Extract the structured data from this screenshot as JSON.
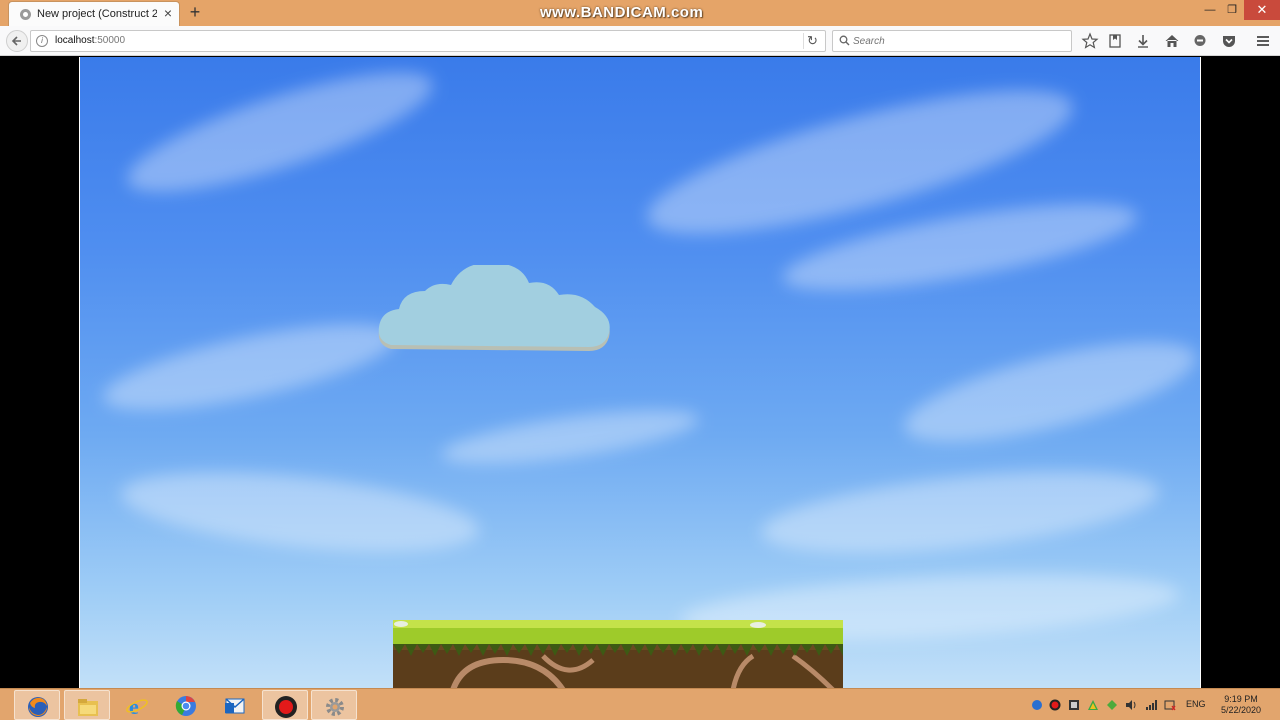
{
  "browser": {
    "tab_title": "New project (Construct 2 ...",
    "watermark": "www.BANDICAM.com",
    "url_host": "localhost",
    "url_port": ":50000",
    "search_placeholder": "Search"
  },
  "taskbar": {
    "language": "ENG",
    "time": "9:19 PM",
    "date": "5/22/2020",
    "pinned": [
      "firefox-icon",
      "file-explorer-icon",
      "internet-explorer-icon",
      "chrome-icon",
      "outlook-icon",
      "bandicam-icon",
      "settings-icon"
    ]
  },
  "game": {
    "sky_color": "#4f8ef0",
    "cloud_color": "#a2cfe0",
    "grass_color": "#9ecb2a",
    "dirt_color": "#6a4a22"
  }
}
